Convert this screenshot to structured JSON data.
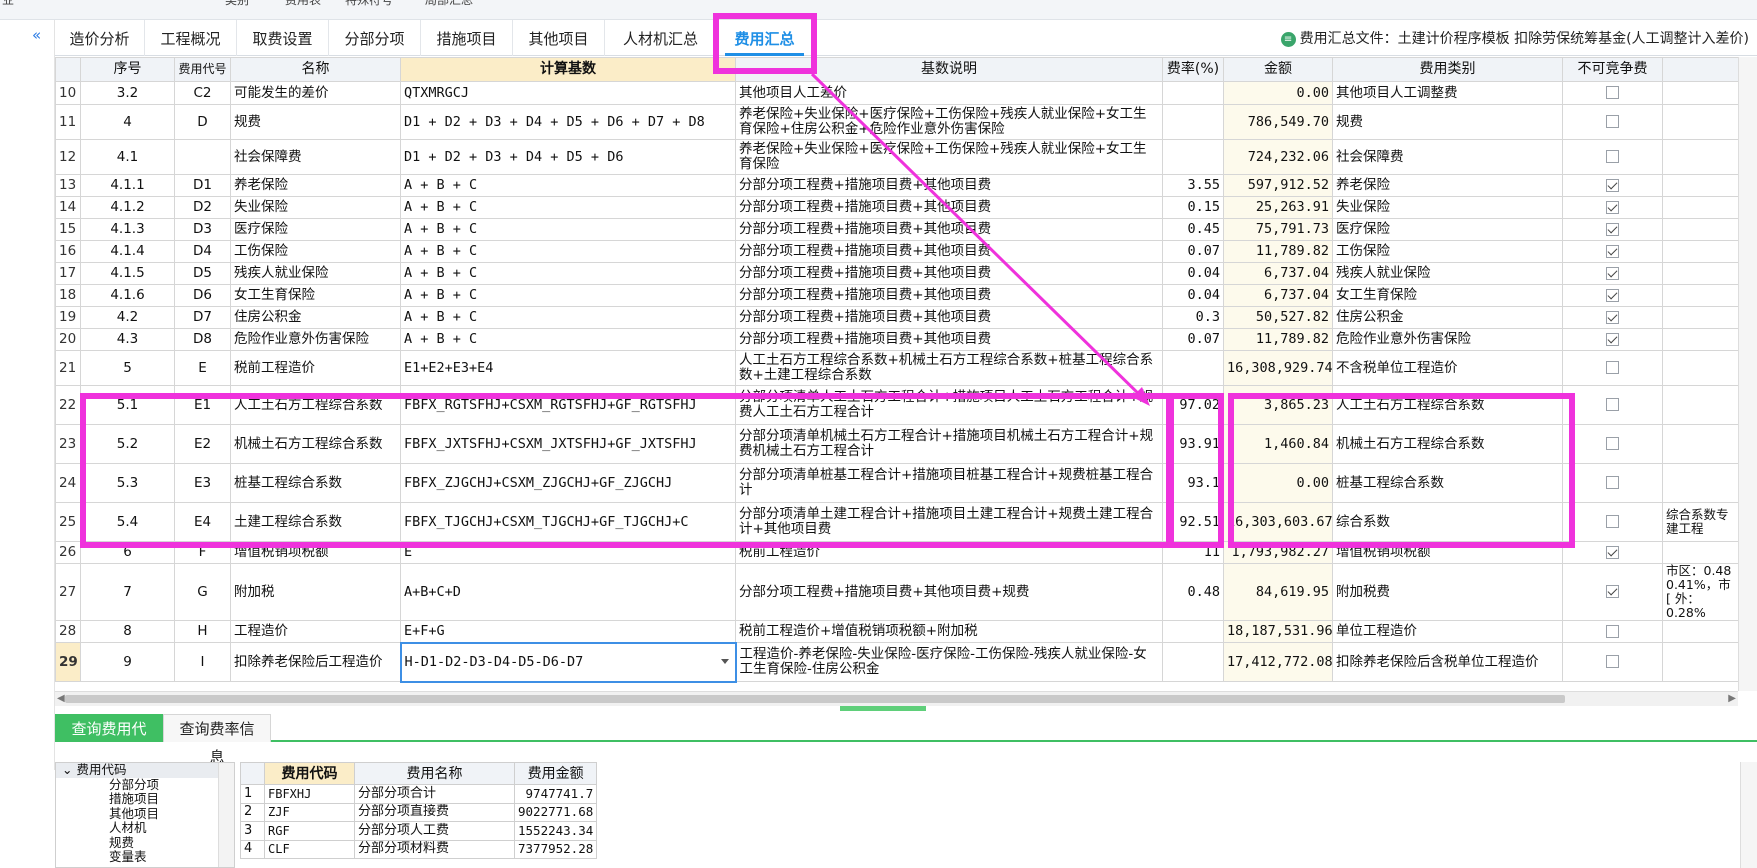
{
  "top_strip": {
    "items": [
      "业",
      "类别",
      "费用表",
      "特殊符号",
      "局部汇总"
    ]
  },
  "tabs": [
    {
      "label": "造价分析",
      "active": false
    },
    {
      "label": "工程概况",
      "active": false
    },
    {
      "label": "取费设置",
      "active": false
    },
    {
      "label": "分部分项",
      "active": false
    },
    {
      "label": "措施项目",
      "active": false
    },
    {
      "label": "其他项目",
      "active": false
    },
    {
      "label": "人材机汇总",
      "active": false
    },
    {
      "label": "费用汇总",
      "active": true
    }
  ],
  "file_info": {
    "icon": "document-icon",
    "text": "费用汇总文件：土建计价程序模板 扣除劳保统筹基金(人工调整计入差价)"
  },
  "table": {
    "headers": [
      "序号",
      "费用代号",
      "名称",
      "计算基数",
      "基数说明",
      "费率(%)",
      "金额",
      "费用类别",
      "不可竞争费",
      ""
    ],
    "rows": [
      {
        "rn": "10",
        "seq": "3.2",
        "code": "C2",
        "name": "可能发生的差价",
        "base": "QTXMRGCJ",
        "desc": "其他项目人工差价",
        "rate": "",
        "amount": "0.00",
        "cat": "其他项目人工调整费",
        "chk": false,
        "extra": ""
      },
      {
        "rn": "11",
        "seq": "4",
        "code": "D",
        "name": "规费",
        "base": "D1 + D2 + D3 + D4 + D5 + D6 + D7 + D8",
        "desc": "养老保险+失业保险+医疗保险+工伤保险+残疾人就业保险+女工生育保险+住房公积金+危险作业意外伤害保险",
        "rate": "",
        "amount": "786,549.70",
        "cat": "规费",
        "chk": false,
        "extra": ""
      },
      {
        "rn": "12",
        "seq": "4.1",
        "code": "",
        "name": "社会保障费",
        "base": "D1 + D2 + D3 + D4 + D5 + D6",
        "desc": "养老保险+失业保险+医疗保险+工伤保险+残疾人就业保险+女工生育保险",
        "rate": "",
        "amount": "724,232.06",
        "cat": "社会保障费",
        "chk": false,
        "extra": ""
      },
      {
        "rn": "13",
        "seq": "4.1.1",
        "code": "D1",
        "name": "养老保险",
        "base": "A + B + C",
        "desc": "分部分项工程费+措施项目费+其他项目费",
        "rate": "3.55",
        "amount": "597,912.52",
        "cat": "养老保险",
        "chk": true,
        "extra": ""
      },
      {
        "rn": "14",
        "seq": "4.1.2",
        "code": "D2",
        "name": "失业保险",
        "base": "A + B + C",
        "desc": "分部分项工程费+措施项目费+其他项目费",
        "rate": "0.15",
        "amount": "25,263.91",
        "cat": "失业保险",
        "chk": true,
        "extra": ""
      },
      {
        "rn": "15",
        "seq": "4.1.3",
        "code": "D3",
        "name": "医疗保险",
        "base": "A + B + C",
        "desc": "分部分项工程费+措施项目费+其他项目费",
        "rate": "0.45",
        "amount": "75,791.73",
        "cat": "医疗保险",
        "chk": true,
        "extra": ""
      },
      {
        "rn": "16",
        "seq": "4.1.4",
        "code": "D4",
        "name": "工伤保险",
        "base": "A + B + C",
        "desc": "分部分项工程费+措施项目费+其他项目费",
        "rate": "0.07",
        "amount": "11,789.82",
        "cat": "工伤保险",
        "chk": true,
        "extra": ""
      },
      {
        "rn": "17",
        "seq": "4.1.5",
        "code": "D5",
        "name": "残疾人就业保险",
        "base": "A + B + C",
        "desc": "分部分项工程费+措施项目费+其他项目费",
        "rate": "0.04",
        "amount": "6,737.04",
        "cat": "残疾人就业保险",
        "chk": true,
        "extra": ""
      },
      {
        "rn": "18",
        "seq": "4.1.6",
        "code": "D6",
        "name": "女工生育保险",
        "base": "A + B + C",
        "desc": "分部分项工程费+措施项目费+其他项目费",
        "rate": "0.04",
        "amount": "6,737.04",
        "cat": "女工生育保险",
        "chk": true,
        "extra": ""
      },
      {
        "rn": "19",
        "seq": "4.2",
        "code": "D7",
        "name": "住房公积金",
        "base": "A + B + C",
        "desc": "分部分项工程费+措施项目费+其他项目费",
        "rate": "0.3",
        "amount": "50,527.82",
        "cat": "住房公积金",
        "chk": true,
        "extra": ""
      },
      {
        "rn": "20",
        "seq": "4.3",
        "code": "D8",
        "name": "危险作业意外伤害保险",
        "base": "A + B + C",
        "desc": "分部分项工程费+措施项目费+其他项目费",
        "rate": "0.07",
        "amount": "11,789.82",
        "cat": "危险作业意外伤害保险",
        "chk": true,
        "extra": ""
      },
      {
        "rn": "21",
        "seq": "5",
        "code": "E",
        "name": "税前工程造价",
        "base": "E1+E2+E3+E4",
        "desc": "人工土石方工程综合系数+机械土石方工程综合系数+桩基工程综合系数+土建工程综合系数",
        "rate": "",
        "amount": "16,308,929.74",
        "cat": "不含税单位工程造价",
        "chk": false,
        "extra": ""
      },
      {
        "rn": "22",
        "seq": "5.1",
        "code": "E1",
        "name": "人工土石方工程综合系数",
        "base": "FBFX_RGTSFHJ+CSXM_RGTSFHJ+GF_RGTSFHJ",
        "desc": "分部分项清单人工土石方工程合计+措施项目人工土石方工程合计+规费人工土石方工程合计",
        "rate": "97.02",
        "amount": "3,865.23",
        "cat": "人工土石方工程综合系数",
        "chk": false,
        "extra": ""
      },
      {
        "rn": "23",
        "seq": "5.2",
        "code": "E2",
        "name": "机械土石方工程综合系数",
        "base": "FBFX_JXTSFHJ+CSXM_JXTSFHJ+GF_JXTSFHJ",
        "desc": "分部分项清单机械土石方工程合计+措施项目机械土石方工程合计+规费机械土石方工程合计",
        "rate": "93.91",
        "amount": "1,460.84",
        "cat": "机械土石方工程综合系数",
        "chk": false,
        "extra": ""
      },
      {
        "rn": "24",
        "seq": "5.3",
        "code": "E3",
        "name": "桩基工程综合系数",
        "base": "FBFX_ZJGCHJ+CSXM_ZJGCHJ+GF_ZJGCHJ",
        "desc": "分部分项清单桩基工程合计+措施项目桩基工程合计+规费桩基工程合计",
        "rate": "93.1",
        "amount": "0.00",
        "cat": "桩基工程综合系数",
        "chk": false,
        "extra": ""
      },
      {
        "rn": "25",
        "seq": "5.4",
        "code": "E4",
        "name": "土建工程综合系数",
        "base": "FBFX_TJGCHJ+CSXM_TJGCHJ+GF_TJGCHJ+C",
        "desc": "分部分项清单土建工程合计+措施项目土建工程合计+规费土建工程合计+其他项目费",
        "rate": "92.51",
        "amount": "16,303,603.67",
        "cat": "综合系数",
        "chk": false,
        "extra": "综合系数专建工程"
      },
      {
        "rn": "26",
        "seq": "6",
        "code": "F",
        "name": "增值税销项税额",
        "base": "E",
        "desc": "税前工程造价",
        "rate": "11",
        "amount": "1,793,982.27",
        "cat": "增值税销项税额",
        "chk": true,
        "extra": ""
      },
      {
        "rn": "27",
        "seq": "7",
        "code": "G",
        "name": "附加税",
        "base": "A+B+C+D",
        "desc": "分部分项工程费+措施项目费+其他项目费+规费",
        "rate": "0.48",
        "amount": "84,619.95",
        "cat": "附加税费",
        "chk": true,
        "extra": "市区：0.48 0.41%，市[ 外：0.28%"
      },
      {
        "rn": "28",
        "seq": "8",
        "code": "H",
        "name": "工程造价",
        "base": "E+F+G",
        "desc": "税前工程造价+增值税销项税额+附加税",
        "rate": "",
        "amount": "18,187,531.96",
        "cat": "单位工程造价",
        "chk": false,
        "extra": ""
      },
      {
        "rn": "29",
        "seq": "9",
        "code": "I",
        "name": "扣除养老保险后工程造价",
        "base": "H-D1-D2-D3-D4-D5-D6-D7",
        "desc": "工程造价-养老保险-失业保险-医疗保险-工伤保险-残疾人就业保险-女工生育保险-住房公积金",
        "rate": "",
        "amount": "17,412,772.08",
        "cat": "扣除养老保险后含税单位工程造价",
        "chk": false,
        "extra": ""
      }
    ]
  },
  "bottom_tabs": [
    {
      "label": "查询费用代码",
      "active": true
    },
    {
      "label": "查询费率信息",
      "active": false
    }
  ],
  "tree": {
    "root": "费用代码",
    "children": [
      "分部分项",
      "措施项目",
      "其他项目",
      "人材机",
      "规费",
      "变量表"
    ]
  },
  "code_table": {
    "headers": [
      "",
      "费用代码",
      "费用名称",
      "费用金额"
    ],
    "rows": [
      {
        "n": "1",
        "code": "FBFXHJ",
        "name": "分部分项合计",
        "amount": "9747741.7"
      },
      {
        "n": "2",
        "code": "ZJF",
        "name": "分部分项直接费",
        "amount": "9022771.68"
      },
      {
        "n": "3",
        "code": "RGF",
        "name": "分部分项人工费",
        "amount": "1552243.34"
      },
      {
        "n": "4",
        "code": "CLF",
        "name": "分部分项材料费",
        "amount": "7377952.28"
      }
    ]
  },
  "colors": {
    "accent": "#1f8fe6",
    "annotation": "#ef32dc",
    "highlight": "#fbedc8",
    "green": "#3fbf63"
  }
}
